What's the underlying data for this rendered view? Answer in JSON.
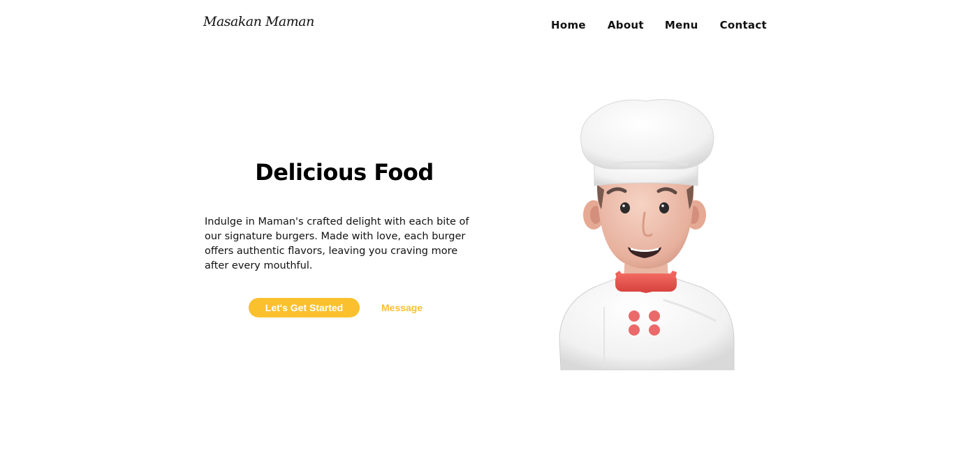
{
  "header": {
    "logo_text": "Masakan Maman",
    "nav": [
      {
        "label": "Home"
      },
      {
        "label": "About"
      },
      {
        "label": "Menu"
      },
      {
        "label": "Contact"
      }
    ]
  },
  "hero": {
    "title": "Delicious Food",
    "description": "Indulge in Maman's crafted delight with each bite of our signature burgers. Made with love, each burger offers authentic flavors, leaving you craving more after every mouthful.",
    "primary_button": "Let's Get Started",
    "secondary_button": "Message"
  },
  "colors": {
    "accent": "#fbc02d",
    "text": "#111111",
    "background": "#ffffff",
    "chef_collar": "#e8544f"
  },
  "illustration": {
    "icon": "chef-illustration"
  }
}
